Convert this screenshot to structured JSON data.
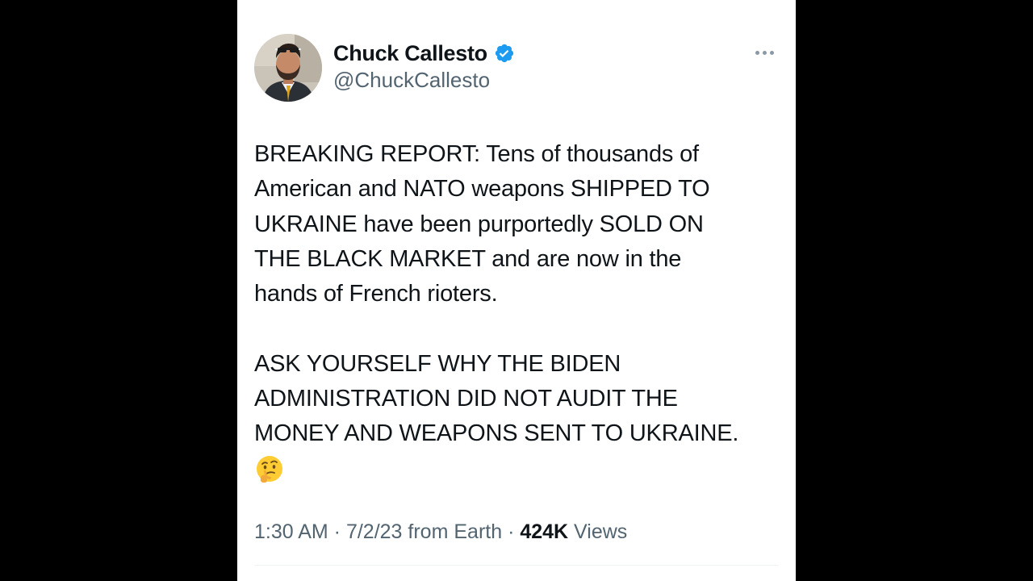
{
  "author": {
    "display_name": "Chuck Callesto",
    "handle": "@ChuckCallesto",
    "verified": true,
    "verified_color": "#1d9bf0"
  },
  "tweet": {
    "paragraph_1_lines": [
      "BREAKING REPORT: Tens of thousands of",
      "American and NATO weapons SHIPPED TO",
      "UKRAINE have been purportedly SOLD ON",
      "THE BLACK MARKET and are now in the",
      "hands of French rioters."
    ],
    "paragraph_2_lines": [
      "ASK YOURSELF WHY THE BIDEN",
      "ADMINISTRATION DID NOT AUDIT THE",
      "MONEY AND WEAPONS SENT TO UKRAINE."
    ],
    "emoji": "thinking-face-icon"
  },
  "meta": {
    "time": "1:30 AM",
    "separator": " · ",
    "date": "7/2/23",
    "source": " from Earth",
    "views_count": "424K",
    "views_label": " Views"
  },
  "icons": {
    "more": "more-horizontal-icon",
    "verified": "verified-badge-icon"
  }
}
